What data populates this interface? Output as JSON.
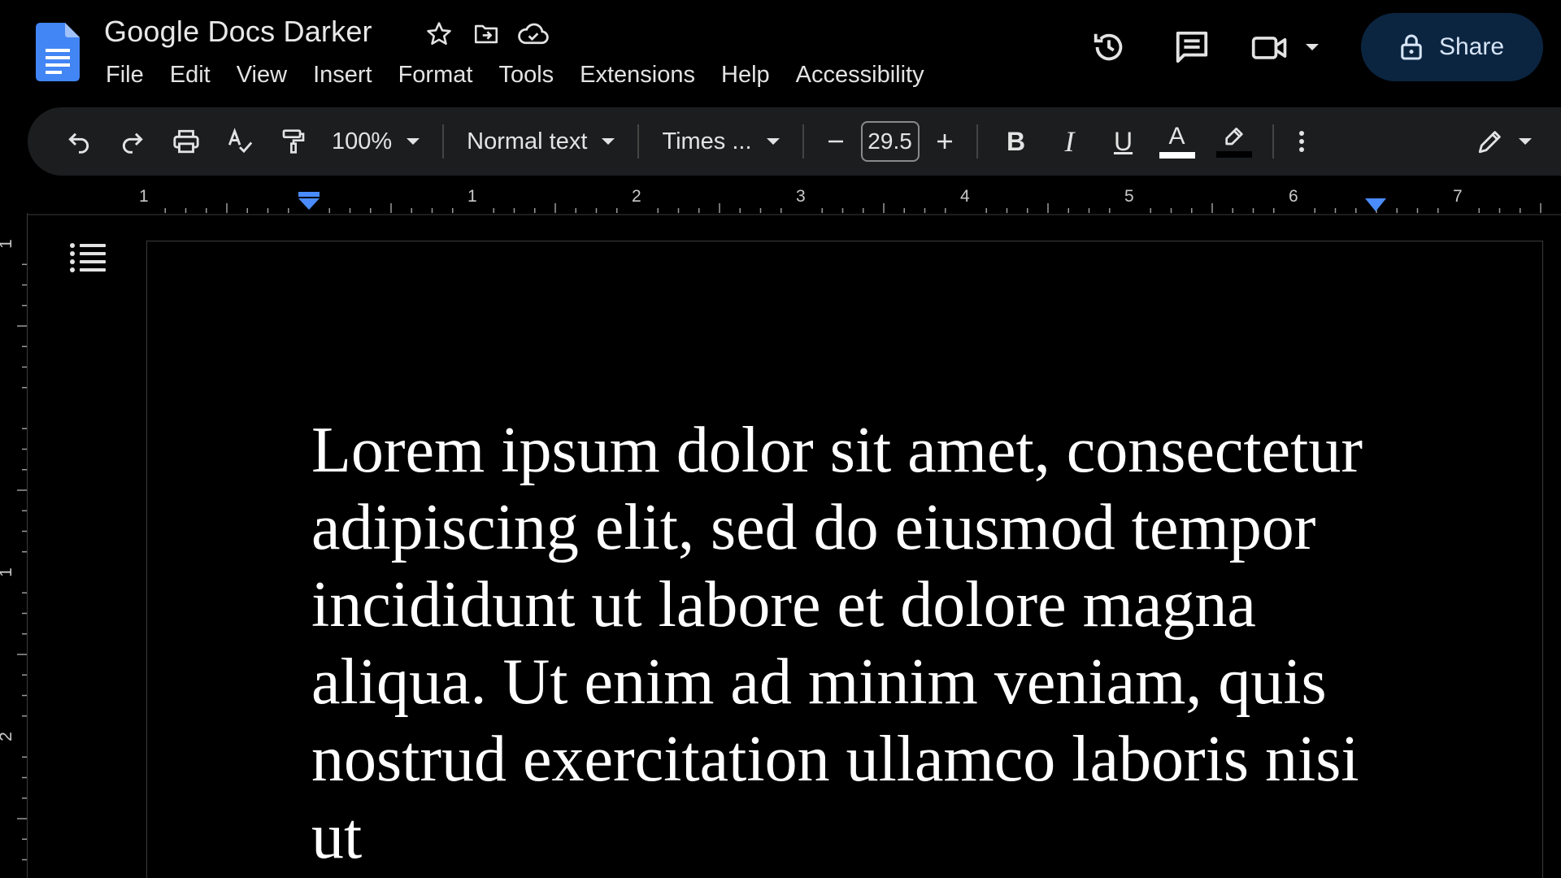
{
  "document": {
    "title": "Google Docs Darker",
    "body_text": "Lorem ipsum dolor sit amet, consectetur adipiscing elit, sed do eiusmod tempor incididunt ut labore et dolore magna aliqua. Ut enim ad minim veniam, quis nostrud exercitation ullamco laboris nisi ut"
  },
  "title_icons": [
    "star-icon",
    "move-to-folder-icon",
    "cloud-saved-icon"
  ],
  "menu": [
    "File",
    "Edit",
    "View",
    "Insert",
    "Format",
    "Tools",
    "Extensions",
    "Help",
    "Accessibility"
  ],
  "header_actions": {
    "history_icon": "version-history-icon",
    "comments_icon": "comments-icon",
    "meet_icon": "video-camera-icon",
    "share_label": "Share"
  },
  "toolbar": {
    "zoom": "100%",
    "style": "Normal text",
    "font": "Times ...",
    "font_size": "29.5",
    "bold": "B",
    "italic": "I",
    "underline": "U",
    "text_color": "A"
  },
  "ruler": {
    "horizontal_labels": [
      "1",
      "1",
      "2",
      "3",
      "4",
      "5",
      "6",
      "7"
    ],
    "vertical_labels": [
      "1",
      "1",
      "2"
    ]
  },
  "colors": {
    "background": "#000000",
    "toolbar": "#1c1d1f",
    "share_button": "#0b2541",
    "docs_blue": "#4285f4",
    "ruler_marker": "#4a8cff"
  }
}
